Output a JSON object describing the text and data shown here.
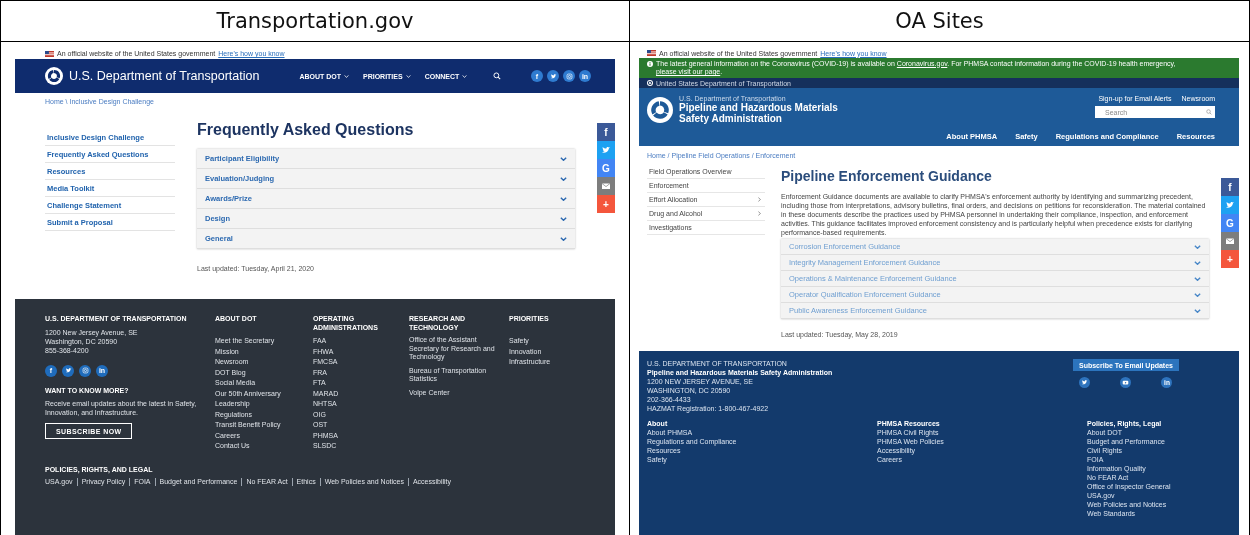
{
  "panels": [
    {
      "kind": "dot",
      "title": "Transportation.gov",
      "site": {
        "gov_banner": {
          "text": "An official website of the United States government",
          "link": "Here's how you know"
        },
        "header": {
          "title": "U.S. Department of Transportation",
          "nav": [
            "ABOUT DOT",
            "PRIORITIES",
            "CONNECT"
          ],
          "social": [
            {
              "kind": "facebook",
              "glyph": "f"
            },
            {
              "kind": "twitter"
            },
            {
              "kind": "instagram"
            },
            {
              "kind": "linkedin",
              "glyph": "in"
            }
          ]
        },
        "breadcrumb": "Home \\ Inclusive Design Challenge",
        "sidebar": [
          "Inclusive Design Challenge",
          "Frequently Asked Questions",
          "Resources",
          "Media Toolkit",
          "Challenge Statement",
          "Submit a Proposal"
        ],
        "heading": "Frequently Asked Questions",
        "accordion": [
          "Participant Eligibility",
          "Evaluation/Judging",
          "Awards/Prize",
          "Design",
          "General"
        ],
        "last_updated": "Last updated: Tuesday, April 21, 2020",
        "share": [
          {
            "kind": "facebook",
            "glyph": "f"
          },
          {
            "kind": "twitter"
          },
          {
            "kind": "google",
            "glyph": "G"
          },
          {
            "kind": "email"
          },
          {
            "kind": "more",
            "glyph": "+"
          }
        ],
        "footer": {
          "org": "U.S. DEPARTMENT OF TRANSPORTATION",
          "address": [
            "1200 New Jersey Avenue, SE",
            "Washington, DC 20590",
            "855-368-4200"
          ],
          "social": [
            {
              "kind": "facebook",
              "glyph": "f"
            },
            {
              "kind": "twitter"
            },
            {
              "kind": "instagram"
            },
            {
              "kind": "linkedin",
              "glyph": "in"
            }
          ],
          "newsletter": {
            "heading": "WANT TO KNOW MORE?",
            "text": "Receive email updates about the latest in Safety, Innovation, and Infrastructure.",
            "button": "SUBSCRIBE NOW"
          },
          "columns": [
            {
              "heading": "ABOUT DOT",
              "links": [
                "Meet the Secretary",
                "Mission",
                "Newsroom",
                "DOT Blog",
                "Social Media",
                "Our 50th Anniversary",
                "Leadership",
                "Regulations",
                "Transit Benefit Policy",
                "Careers",
                "Contact Us"
              ]
            },
            {
              "heading": "OPERATING ADMINISTRATIONS",
              "links": [
                "FAA",
                "FHWA",
                "FMCSA",
                "FRA",
                "FTA",
                "MARAD",
                "NHTSA",
                "OIG",
                "OST",
                "PHMSA",
                "SLSDC"
              ]
            },
            {
              "heading": "RESEARCH AND TECHNOLOGY",
              "links": [
                "Office of the Assistant Secretary for Research and Technology",
                "Bureau of Transportation Statistics",
                "Volpe Center"
              ]
            },
            {
              "heading": "PRIORITIES",
              "links": [
                "Safety",
                "Innovation",
                "Infrastructure"
              ]
            }
          ],
          "policies": {
            "heading": "POLICIES, RIGHTS, AND LEGAL",
            "links": [
              "USA.gov",
              "Privacy Policy",
              "FOIA",
              "Budget and Performance",
              "No FEAR Act",
              "Ethics",
              "Web Policies and Notices",
              "Accessibility"
            ]
          }
        }
      }
    },
    {
      "kind": "oa",
      "title": "OA Sites",
      "site": {
        "gov_banner": {
          "text": "An official website of the United States government",
          "link": "Here's how you know"
        },
        "alert": [
          {
            "kind": "text",
            "text": "The latest general information on the Coronavirus (COVID-19) is available on "
          },
          {
            "kind": "link",
            "text": "Coronavirus.gov"
          },
          {
            "kind": "text",
            "text": ". For PHMSA contact information during the COVID-19 health emergency, "
          },
          {
            "kind": "link",
            "text": "please visit our page"
          },
          {
            "kind": "text",
            "text": "."
          }
        ],
        "dept_strip": "United States Department of Transportation",
        "header": {
          "agency": "U.S. Department of Transportation",
          "name": [
            "Pipeline and Hazardous Materials",
            "Safety Administration"
          ],
          "links": [
            "Sign-up for Email Alerts",
            "Newsroom"
          ],
          "search_placeholder": "Search",
          "nav": [
            "About PHMSA",
            "Safety",
            "Regulations and Compliance",
            "Resources"
          ]
        },
        "breadcrumb": "Home / Pipeline Field Operations / Enforcement",
        "sidebar": [
          {
            "label": "Field Operations Overview",
            "expandable": false
          },
          {
            "label": "Enforcement",
            "expandable": false
          },
          {
            "label": "Effort Allocation",
            "expandable": true
          },
          {
            "label": "Drug and Alcohol",
            "expandable": true
          },
          {
            "label": "Investigations",
            "expandable": false
          }
        ],
        "heading": "Pipeline Enforcement Guidance",
        "intro": "Enforcement Guidance documents are available to clarify PHMSA's enforcement authority by identifying and summarizing precedent, including those from interpretations, advisory bulletins, final orders, and decisions on petitions for reconsideration.  The material contained in these documents describe the practices used by PHMSA personnel in undertaking their compliance, inspection, and enforcement activities.  This guidance facilitates improved enforcement consistency and is particularly helpful when precedence exists for clarifying performance-based requirements.",
        "accordion": [
          "Corrosion Enforcement Guidance",
          "Integrity Management Enforcement Guidance",
          "Operations & Maintenance Enforcement Guidance",
          "Operator Qualification Enforcement Guidance",
          "Public Awareness Enforcement Guidance"
        ],
        "last_updated": "Last updated: Tuesday, May 28, 2019",
        "share": [
          {
            "kind": "facebook",
            "glyph": "f"
          },
          {
            "kind": "twitter"
          },
          {
            "kind": "google",
            "glyph": "G"
          },
          {
            "kind": "email"
          },
          {
            "kind": "more",
            "glyph": "+"
          }
        ],
        "footer": {
          "lines": [
            "U.S. DEPARTMENT OF TRANSPORTATION",
            "Pipeline and Hazardous Materials Safety Administration",
            "1200 NEW JERSEY AVENUE, SE",
            "WASHINGTON, DC 20590",
            "202-366-4433",
            "HAZMAT Registration: 1-800-467-4922"
          ],
          "button": "Subscribe To Email Updates",
          "social": [
            {
              "kind": "twitter"
            },
            {
              "kind": "youtube"
            },
            {
              "kind": "linkedin",
              "glyph": "in"
            }
          ],
          "columns": [
            {
              "heading": "About",
              "links": [
                "About PHMSA",
                "Regulations and Compliance",
                "Resources",
                "Safety"
              ]
            },
            {
              "heading": "PHMSA Resources",
              "links": [
                "PHMSA Civil Rights",
                "PHMSA Web Policies",
                "Accessibility",
                "Careers"
              ]
            },
            {
              "heading": "Policies, Rights, Legal",
              "links": [
                "About DOT",
                "Budget and Performance",
                "Civil Rights",
                "FOIA",
                "Information Quality",
                "No FEAR Act",
                "Office of Inspector General",
                "USA.gov",
                "Web Policies and Notices",
                "Web Standards"
              ]
            }
          ]
        }
      }
    }
  ]
}
